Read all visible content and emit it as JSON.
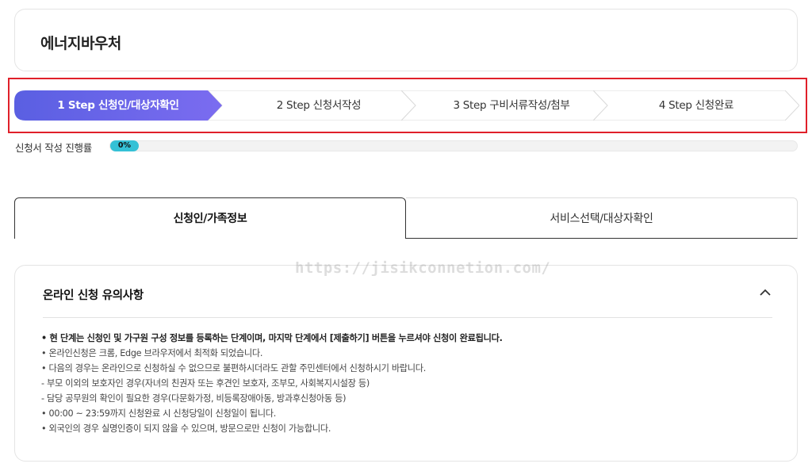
{
  "header": {
    "title": "에너지바우처"
  },
  "steps": [
    {
      "label": "1 Step 신청인/대상자확인",
      "active": true
    },
    {
      "label": "2 Step 신청서작성",
      "active": false
    },
    {
      "label": "3 Step 구비서류작성/첨부",
      "active": false
    },
    {
      "label": "4 Step 신청완료",
      "active": false
    }
  ],
  "progress": {
    "label": "신청서 작성 진행률",
    "percent_text": "0%",
    "value": 0
  },
  "tabs": {
    "active": "신청인/가족정보",
    "inactive": "서비스선택/대상자확인"
  },
  "watermark": "https://jisikconnetion.com/",
  "notice": {
    "title": "온라인 신청 유의사항",
    "items": [
      "• 현 단계는 신청인 및 가구원 구성 정보를 등록하는 단계이며, 마지막 단계에서 [제출하기] 버튼을 누르셔야 신청이 완료됩니다.",
      "• 온라인신청은 크롬, Edge 브라우저에서 최적화 되었습니다.",
      "• 다음의 경우는 온라인으로 신청하실 수 없으므로 불편하시더라도 관할 주민센터에서 신청하시기 바랍니다.",
      "  - 부모 이외의 보호자인 경우(자녀의 친권자 또는 후견인 보호자, 조부모, 사회복지시설장 등)",
      "  - 담당 공무원의 확인이 필요한 경우(다문화가정, 비등록장애아동, 방과후신청아동 등)",
      "• 00:00 ~ 23:59까지 신청완료 시 신청당일이 신청일이 됩니다.",
      "• 외국인의 경우 실명인증이 되지 않을 수 있으며, 방문으로만 신청이 가능합니다."
    ]
  },
  "colors": {
    "accent": "#5b5fe6",
    "progress": "#35c1d6",
    "highlight": "#e0202a"
  },
  "icons": {
    "collapse": "chevron-up-icon"
  }
}
